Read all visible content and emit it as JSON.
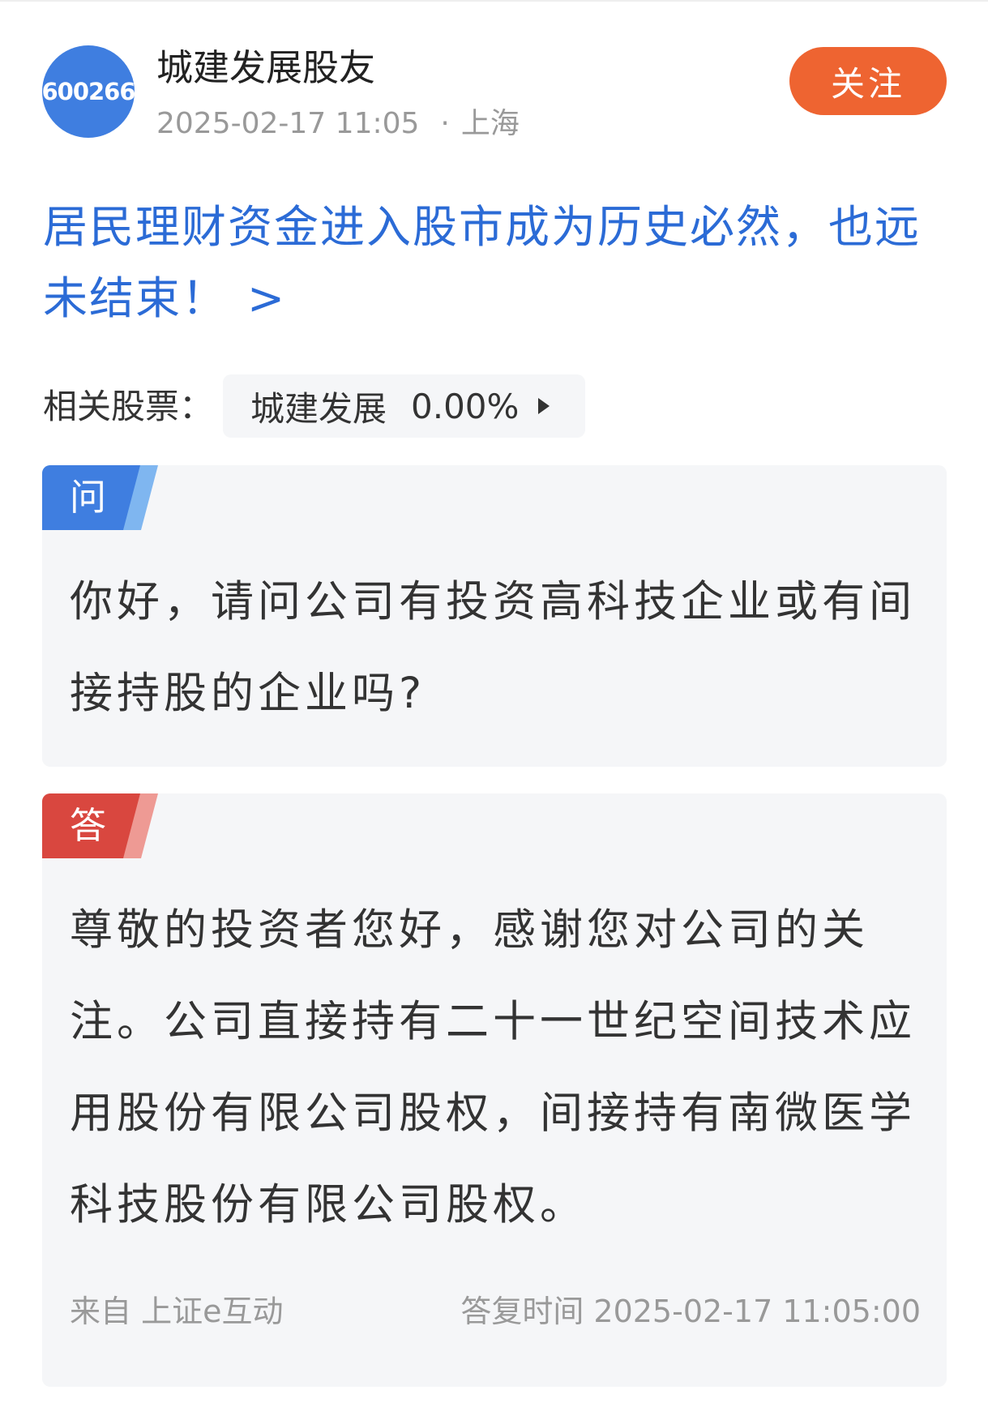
{
  "header": {
    "avatar_text": "600266",
    "username": "城建发展股友",
    "post_time": "2025-02-17 11:05",
    "separator": "·",
    "location": "上海",
    "follow_label": "关注"
  },
  "post": {
    "title": "居民理财资金进入股市成为历史必然，也远未结束！",
    "title_chevron": ">"
  },
  "related_stock": {
    "label": "相关股票：",
    "name": "城建发展",
    "change": "0.00%"
  },
  "question": {
    "tag": "问",
    "text": "你好，请问公司有投资高科技企业或有间接持股的企业吗?"
  },
  "answer": {
    "tag": "答",
    "text": "尊敬的投资者您好，感谢您对公司的关注。公司直接持有二十一世纪空间技术应用股份有限公司股权，间接持有南微医学科技股份有限公司股权。",
    "source_label": "来自 上证e互动",
    "reply_time_label": "答复时间",
    "reply_time": "2025-02-17 11:05:00"
  },
  "colors": {
    "accent_blue": "#2b6bd6",
    "follow_orange": "#ee6431",
    "question_tag": "#3f7ee0",
    "answer_tag": "#d9473f"
  }
}
